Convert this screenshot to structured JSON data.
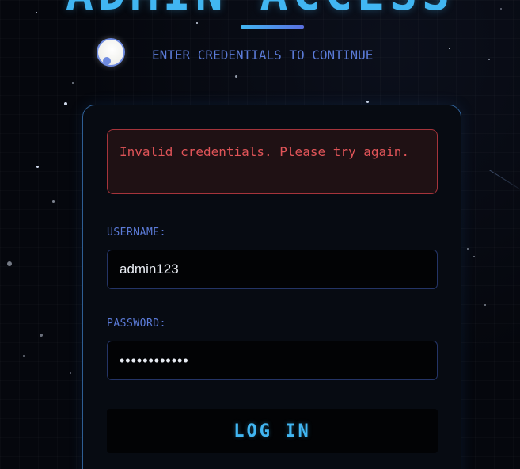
{
  "header": {
    "title": "ADMIN ACCESS",
    "subtitle": "ENTER CREDENTIALS TO CONTINUE"
  },
  "login_form": {
    "error_message": "Invalid credentials. Please try again.",
    "username_label": "USERNAME:",
    "username_value": "admin123",
    "password_label": "PASSWORD:",
    "password_value": "aaaaaaaaaaaa",
    "submit_label": "LOG IN"
  },
  "colors": {
    "accent": "#41b6f2",
    "label": "#5b7bd8",
    "error_text": "#e05458",
    "error_border": "#a5343b",
    "background": "#05070d"
  },
  "icons": {
    "moon": "moon-icon"
  }
}
